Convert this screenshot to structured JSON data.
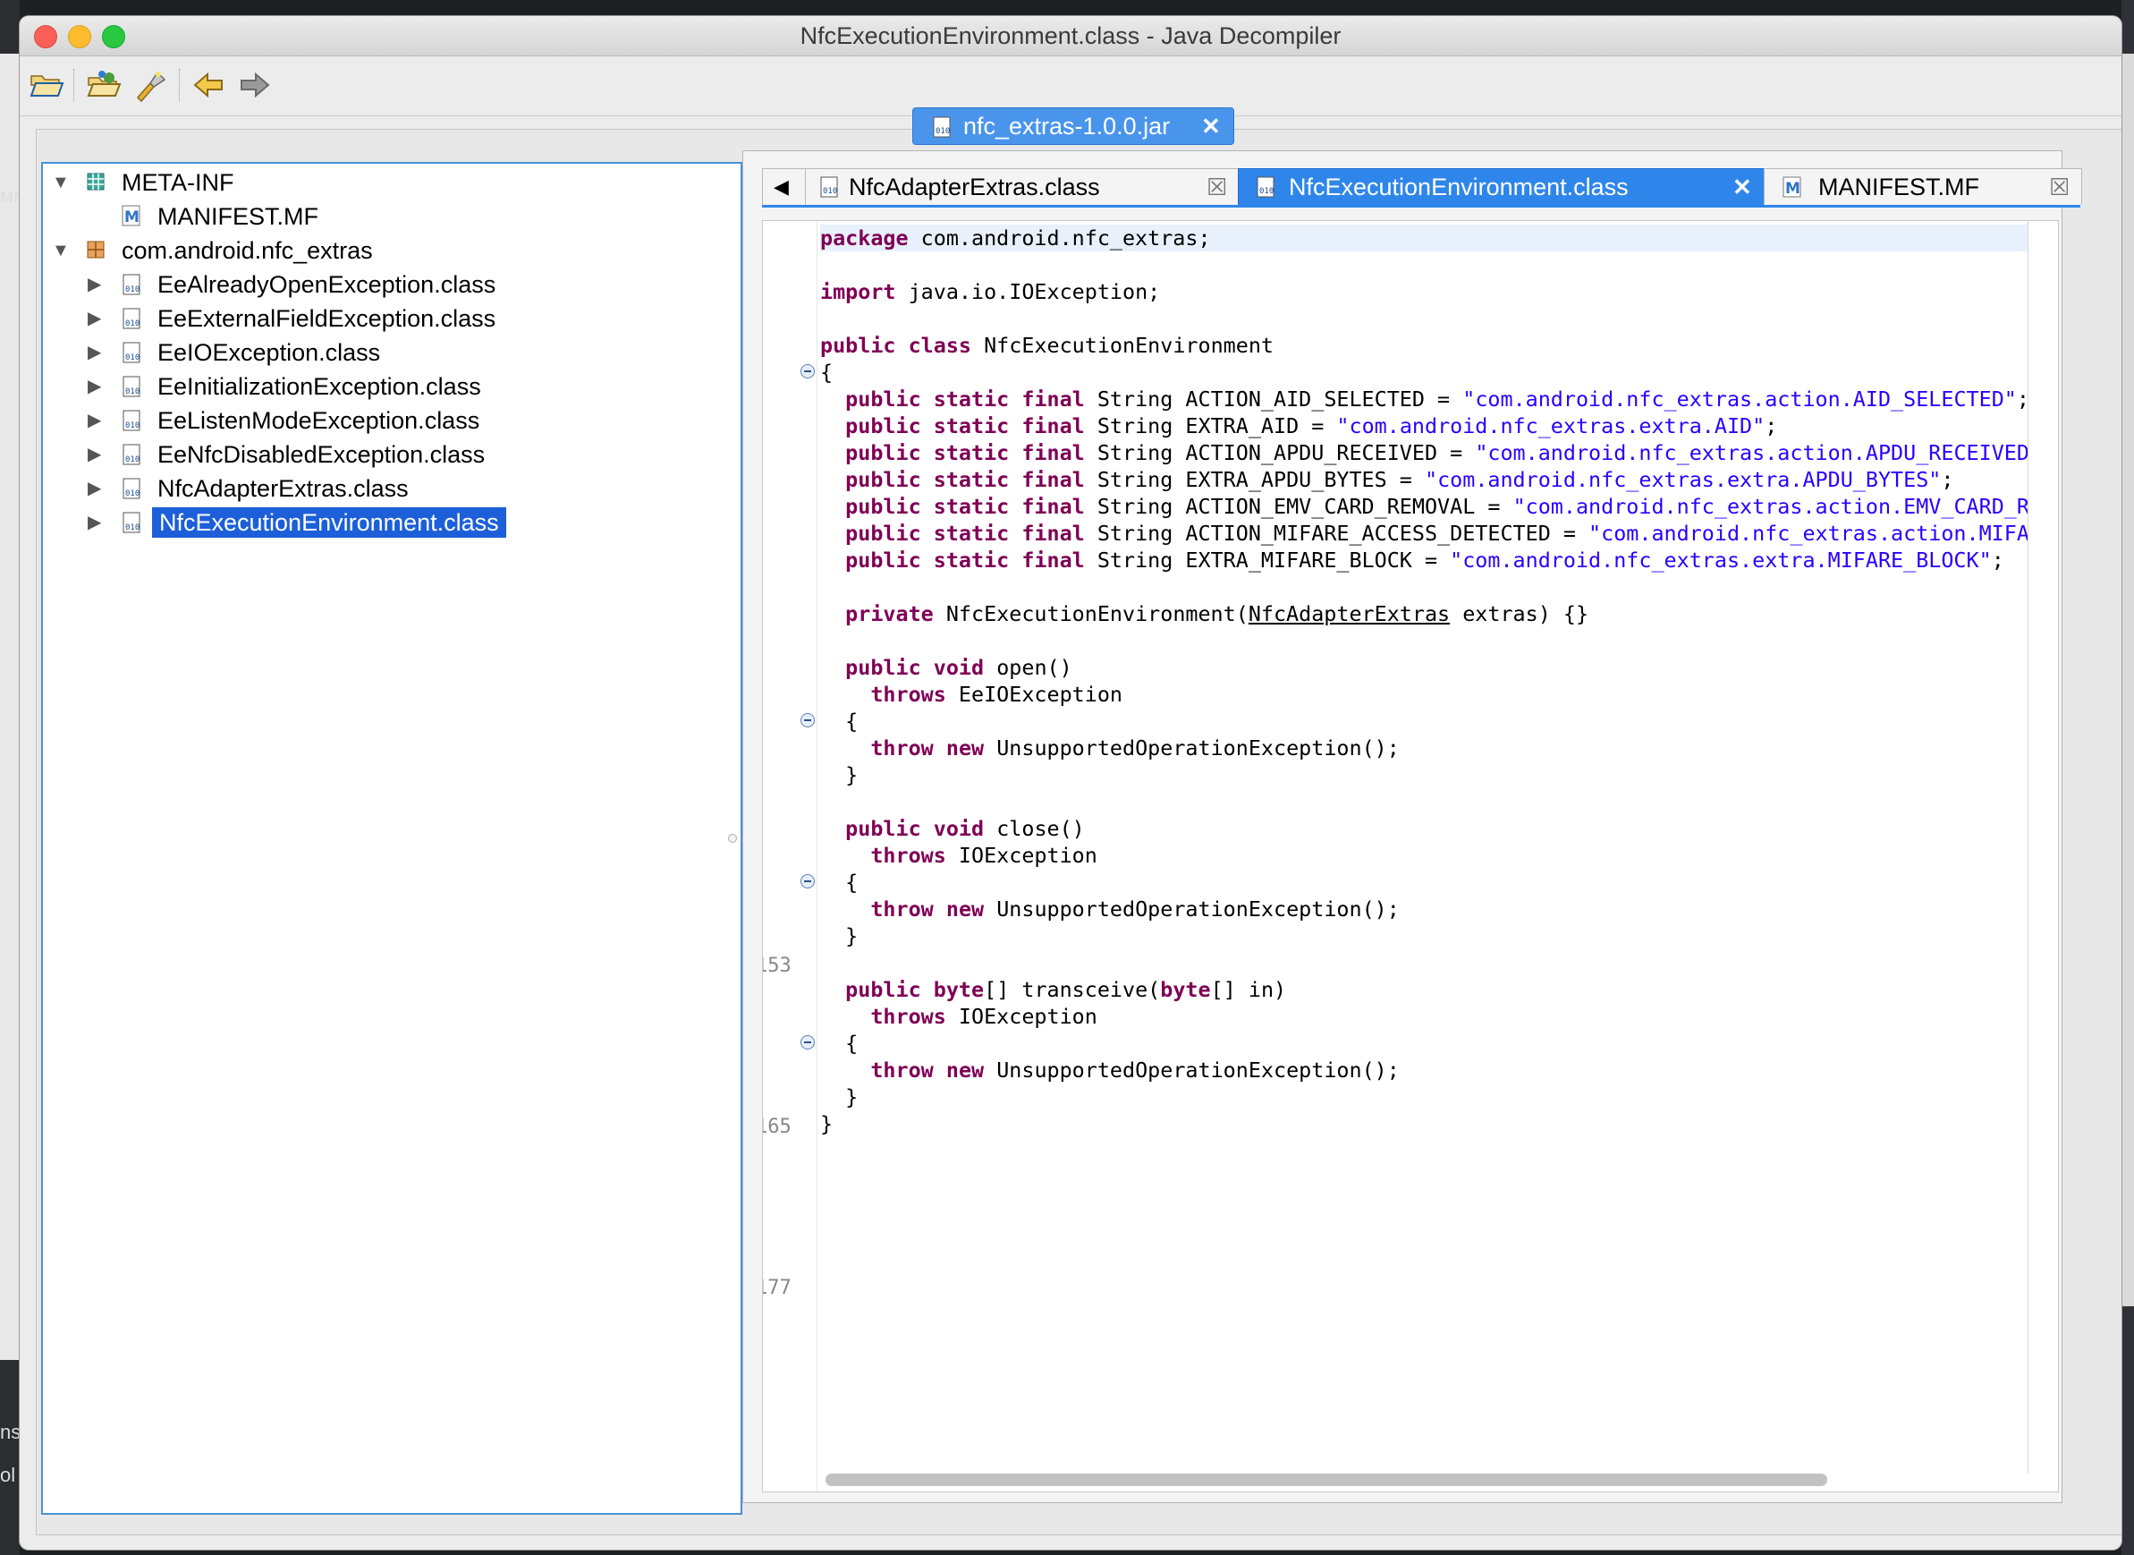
{
  "window": {
    "title": "NfcExecutionEnvironment.class - Java Decompiler"
  },
  "background": {
    "left_text_1": "мм",
    "left_text_2": "ns",
    "left_text_3": "ol"
  },
  "toolbar": {
    "open_icon": "folder-open-icon",
    "open_type_icon": "open-type-icon",
    "search_icon": "flashlight-search-icon",
    "back_icon": "back-arrow-icon",
    "forward_icon": "forward-arrow-icon"
  },
  "jar_tab": {
    "label": "nfc_extras-1.0.0.jar",
    "close": "✕"
  },
  "tree": {
    "meta_inf": "META-INF",
    "manifest": "MANIFEST.MF",
    "package": "com.android.nfc_extras",
    "classes": [
      "EeAlreadyOpenException.class",
      "EeExternalFieldException.class",
      "EeIOException.class",
      "EeInitializationException.class",
      "EeListenModeException.class",
      "EeNfcDisabledException.class",
      "NfcAdapterExtras.class",
      "NfcExecutionEnvironment.class"
    ]
  },
  "editor_tabs": {
    "scroll_left": "◀",
    "tabs": [
      {
        "label": "NfcAdapterExtras.class",
        "close": "☒"
      },
      {
        "label": "NfcExecutionEnvironment.class",
        "close": "✕"
      },
      {
        "label": "MANIFEST.MF",
        "close": "☒"
      }
    ]
  },
  "code": {
    "line_numbers": [
      "153",
      "165",
      "177"
    ],
    "package_kw": "package",
    "package_name": " com.android.nfc_extras;",
    "import_kw": "import",
    "import_name": " java.io.IOException;",
    "class_kw1": "public",
    "class_kw2": "class",
    "class_name": " NfcExecutionEnvironment",
    "open_brace": "{",
    "fields": [
      {
        "decl": " String ACTION_AID_SELECTED = ",
        "value": "\"com.android.nfc_extras.action.AID_SELECTED\"",
        "tail": ";"
      },
      {
        "decl": " String EXTRA_AID = ",
        "value": "\"com.android.nfc_extras.extra.AID\"",
        "tail": ";"
      },
      {
        "decl": " String ACTION_APDU_RECEIVED = ",
        "value": "\"com.android.nfc_extras.action.APDU_RECEIVED\"",
        "tail": ""
      },
      {
        "decl": " String EXTRA_APDU_BYTES = ",
        "value": "\"com.android.nfc_extras.extra.APDU_BYTES\"",
        "tail": ";"
      },
      {
        "decl": " String ACTION_EMV_CARD_REMOVAL = ",
        "value": "\"com.android.nfc_extras.action.EMV_CARD_RE",
        "tail": ""
      },
      {
        "decl": " String ACTION_MIFARE_ACCESS_DETECTED = ",
        "value": "\"com.android.nfc_extras.action.MIFAR",
        "tail": ""
      },
      {
        "decl": " String EXTRA_MIFARE_BLOCK = ",
        "value": "\"com.android.nfc_extras.extra.MIFARE_BLOCK\"",
        "tail": ";"
      }
    ],
    "field_mods": "public static final",
    "ctor_kw": "private",
    "ctor_pre": " NfcExecutionEnvironment(",
    "ctor_param_type": "NfcAdapterExtras",
    "ctor_post": " extras) {}",
    "kw_public": "public",
    "kw_void": "void",
    "kw_byte": "byte",
    "kw_throws": "throws",
    "kw_throw": "throw",
    "kw_new": "new",
    "open_sig": " open()",
    "open_throws": " EeIOException",
    "close_sig": " close()",
    "close_throws": " IOException",
    "transceive_a": "[] transceive(",
    "transceive_b": "[] in)",
    "transceive_throws": " IOException",
    "exc": " UnsupportedOperationException();",
    "brace_open": "{",
    "brace_close": "}"
  },
  "colors": {
    "keyword": "#7f0055",
    "string": "#2a00ff",
    "selection": "#1c5fd9",
    "active_tab": "#2f86ea"
  }
}
